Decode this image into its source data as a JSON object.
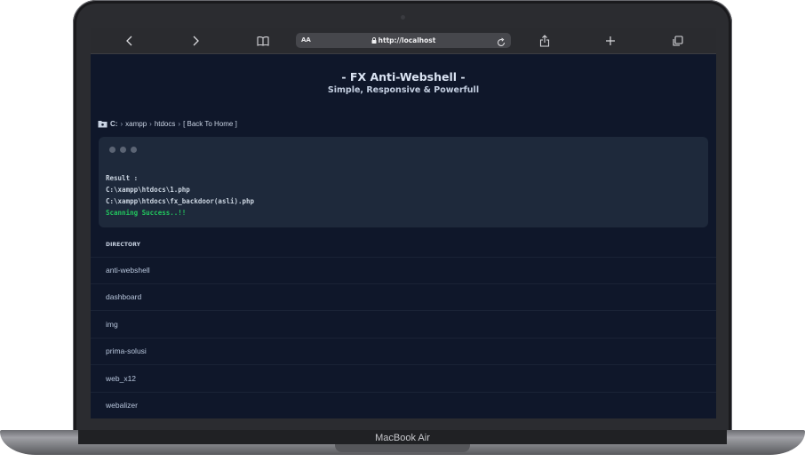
{
  "device": {
    "model_label": "MacBook Air"
  },
  "browser": {
    "aa_label": "AA",
    "url": "http://localhost",
    "icons": [
      "back-icon",
      "forward-icon",
      "bookmarks-icon",
      "lock-icon",
      "reload-icon",
      "share-icon",
      "new-tab-icon",
      "tabs-icon"
    ]
  },
  "page": {
    "title": "- FX Anti-Webshell -",
    "subtitle": "Simple, Responsive & Powerfull",
    "breadcrumb": {
      "drive": "C:",
      "parts": [
        "xampp",
        "htdocs"
      ],
      "back_link": "[ Back To Home ]"
    },
    "result": {
      "label": "Result :",
      "lines": [
        "C:\\xampp\\htdocs\\1.php",
        "C:\\xampp\\htdocs\\fx_backdoor(asli).php"
      ],
      "status": "Scanning Success..!!"
    },
    "directory": {
      "header": "DIRECTORY",
      "items": [
        "anti-webshell",
        "dashboard",
        "img",
        "prima-solusi",
        "web_x12",
        "webalizer"
      ]
    }
  }
}
